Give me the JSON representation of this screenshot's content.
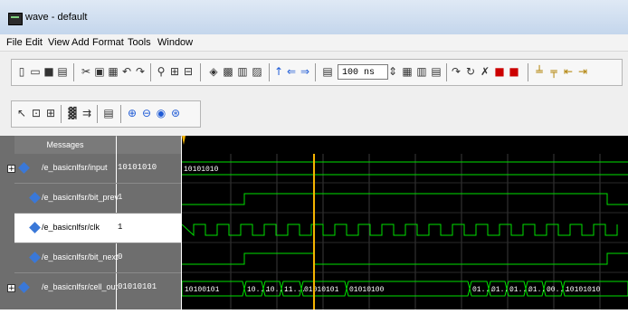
{
  "window": {
    "title": "wave - default"
  },
  "menu": [
    "File",
    "Edit",
    "View",
    "Add",
    "Format",
    "Tools",
    "Window"
  ],
  "toolbar": {
    "zoom_value": "100 ns"
  },
  "panes": {
    "messages_header": "Messages"
  },
  "signals": [
    {
      "name": "/e_basicnlfsr/input",
      "value": "10101010",
      "kind": "bus",
      "expandable": true
    },
    {
      "name": "/e_basicnlfsr/bit_prev",
      "value": "1",
      "kind": "bit",
      "expandable": false
    },
    {
      "name": "/e_basicnlfsr/clk",
      "value": "1",
      "kind": "clock",
      "expandable": false,
      "selected": true
    },
    {
      "name": "/e_basicnlfsr/bit_next",
      "value": "0",
      "kind": "bit",
      "expandable": false
    },
    {
      "name": "/e_basicnlfsr/cell_out",
      "value": "01010101",
      "kind": "bus",
      "expandable": true
    }
  ],
  "waves": {
    "input_label": "10101010",
    "cell_out_labels": [
      "10100101",
      "10...",
      "10...",
      "11...",
      "01010101",
      "01010100",
      "01...",
      "01...",
      "01...",
      "01...",
      "00...",
      "10101010"
    ]
  },
  "colors": {
    "wave": "#00e000",
    "cursor": "#f5b400",
    "selected_bg": "#ffffff",
    "panel": "#6e6e6e"
  }
}
